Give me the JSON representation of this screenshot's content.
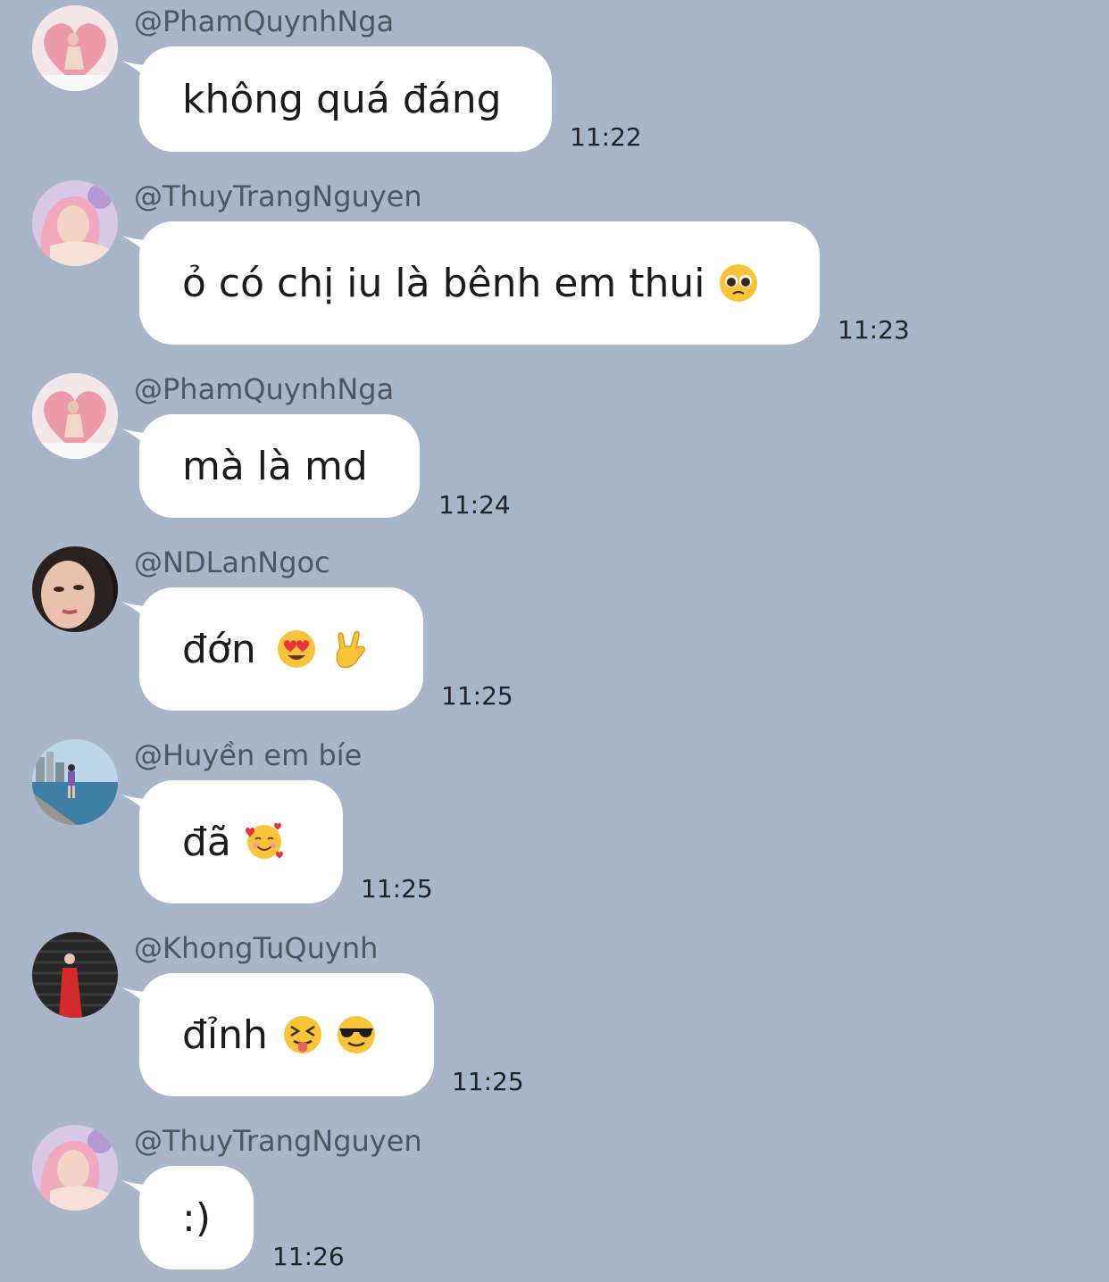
{
  "messages": [
    {
      "sender": "@PhamQuynhNga",
      "text": "không quá đáng",
      "time": "11:22",
      "avatar": "pink-heart-avatar",
      "emojis": []
    },
    {
      "sender": "@ThuyTrangNguyen",
      "text": "ỏ có chị iu là bênh em thui",
      "time": "11:23",
      "avatar": "pink-hair-avatar",
      "emojis": [
        "pleading-face-emoji"
      ]
    },
    {
      "sender": "@PhamQuynhNga",
      "text": "mà là md",
      "time": "11:24",
      "avatar": "pink-heart-avatar",
      "emojis": []
    },
    {
      "sender": "@NDLanNgoc",
      "text": "đớn",
      "time": "11:25",
      "avatar": "dark-hair-avatar",
      "emojis": [
        "heart-eyes-emoji",
        "love-you-gesture-emoji"
      ]
    },
    {
      "sender": "@Huyền em bíe",
      "text": "đã",
      "time": "11:25",
      "avatar": "seaside-photo-avatar",
      "emojis": [
        "smiling-face-with-hearts-emoji"
      ]
    },
    {
      "sender": "@KhongTuQuynh",
      "text": "đỉnh",
      "time": "11:25",
      "avatar": "red-dress-avatar",
      "emojis": [
        "squinting-tongue-emoji",
        "sunglasses-emoji"
      ]
    },
    {
      "sender": "@ThuyTrangNguyen",
      "text": ":)",
      "time": "11:26",
      "avatar": "pink-hair-avatar",
      "emojis": []
    }
  ],
  "colors": {
    "background": "#a9b6c9",
    "bubble": "#ffffff",
    "sender_text": "#4f5661",
    "time_text": "#1f2328"
  }
}
